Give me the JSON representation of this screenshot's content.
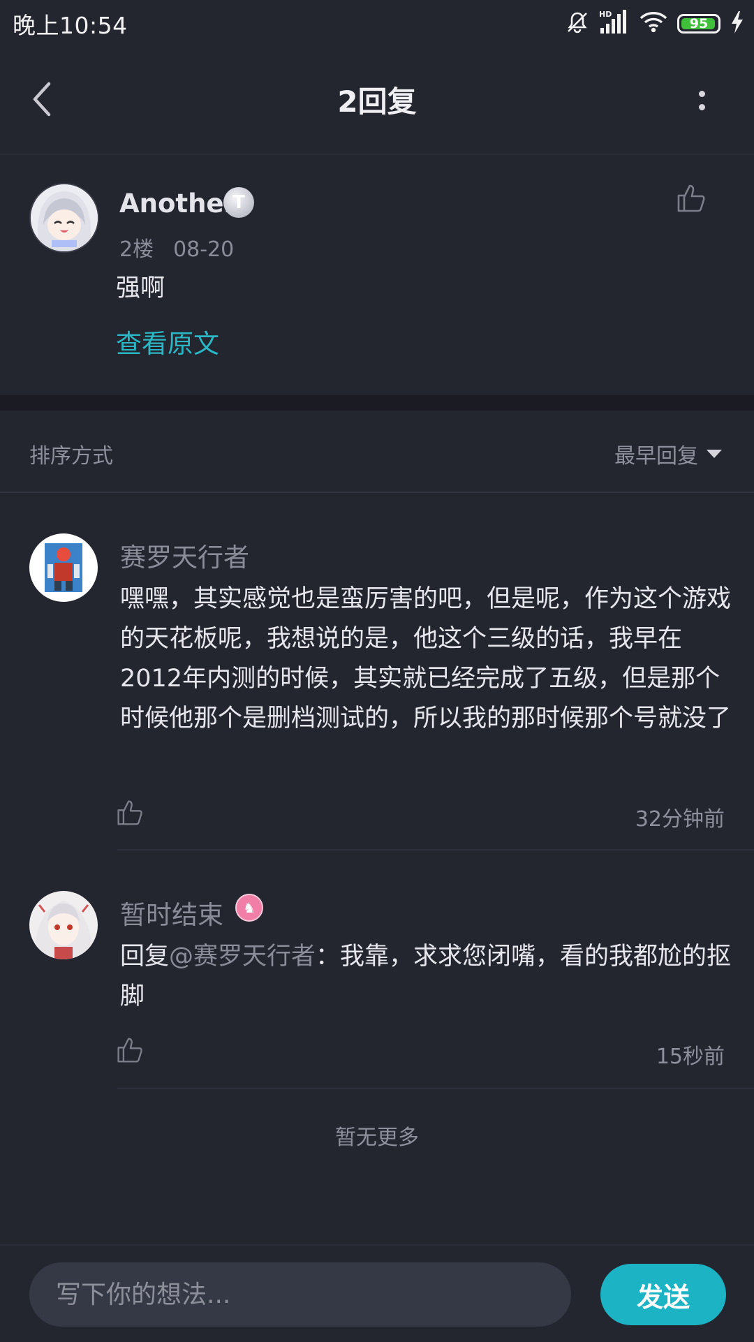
{
  "status_bar": {
    "time": "晚上10:54",
    "battery": "95",
    "battery_level": 0.95,
    "icons": [
      "bell-off-icon",
      "hd-signal-icon",
      "wifi-icon",
      "battery-icon",
      "charging-icon"
    ]
  },
  "header": {
    "title": "2回复",
    "back_icon": "chevron-left-icon",
    "more_icon": "more-vertical-icon"
  },
  "original_post": {
    "author": "Another",
    "badge": "T",
    "floor": "2楼",
    "date": "08-20",
    "content": "强啊",
    "view_original": "查看原文"
  },
  "sort": {
    "label": "排序方式",
    "value": "最早回复"
  },
  "replies": [
    {
      "author": "赛罗天行者",
      "content": "嘿嘿，其实感觉也是蛮厉害的吧，但是呢，作为这个游戏的天花板呢，我想说的是，他这个三级的话，我早在2012年内测的时候，其实就已经完成了五级，但是那个时候他那个是删档测试的，所以我的那时候那个号就没了",
      "time": "32分钟前"
    },
    {
      "author": "暂时结束",
      "reply_prefix": "回复",
      "mention": "@赛罗天行者",
      "content": "：我靠，求求您闭嘴，看的我都尬的抠脚",
      "time": "15秒前"
    }
  ],
  "end_text": "暂无更多",
  "composer": {
    "placeholder": "写下你的想法...",
    "send_label": "发送"
  },
  "colors": {
    "background": "#23252f",
    "accent": "#1cb3c4",
    "link": "#2ab7c6",
    "muted_text": "#8a8c98"
  }
}
